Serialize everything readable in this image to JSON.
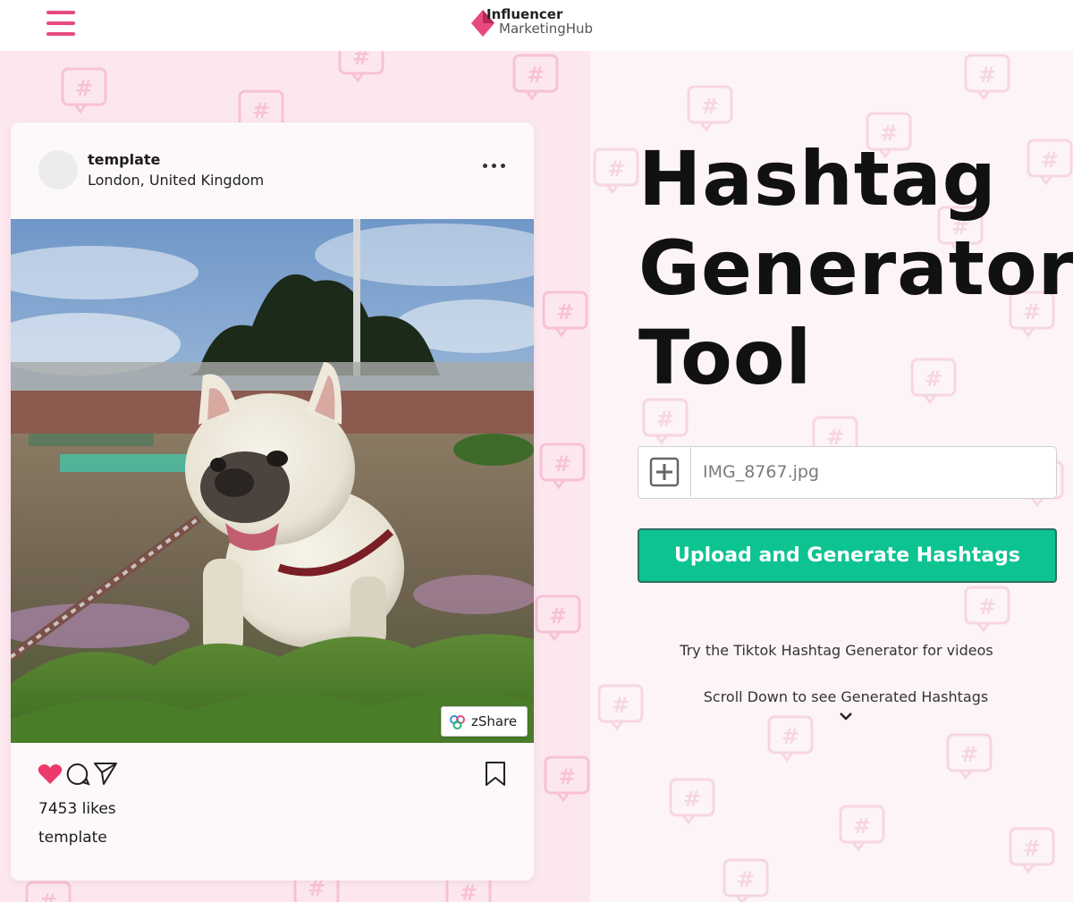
{
  "header": {
    "logo_line1": "Influencer",
    "logo_line2": "MarketingHub",
    "menu_icon": "hamburger-icon"
  },
  "post": {
    "username": "template",
    "location": "London, United Kingdom",
    "likes": "7453 likes",
    "caption": "template",
    "photo_badge": "zShare",
    "icons": [
      "heart-icon",
      "comment-icon",
      "share-icon",
      "bookmark-icon",
      "more-dots-icon"
    ]
  },
  "tool": {
    "title_lines": [
      "Hashtag",
      "Generator",
      "Tool"
    ],
    "file_name": "IMG_8767.jpg",
    "upload_label": "Upload and Generate Hashtags",
    "tiktok_text": "Try the Tiktok Hashtag Generator for videos",
    "scroll_text": "Scroll Down to see Generated Hashtags"
  },
  "colors": {
    "brand_pink": "#e84a7f",
    "upload_green": "#0dc392",
    "left_bg": "#fde7ef",
    "right_bg": "#fdf4f7"
  }
}
